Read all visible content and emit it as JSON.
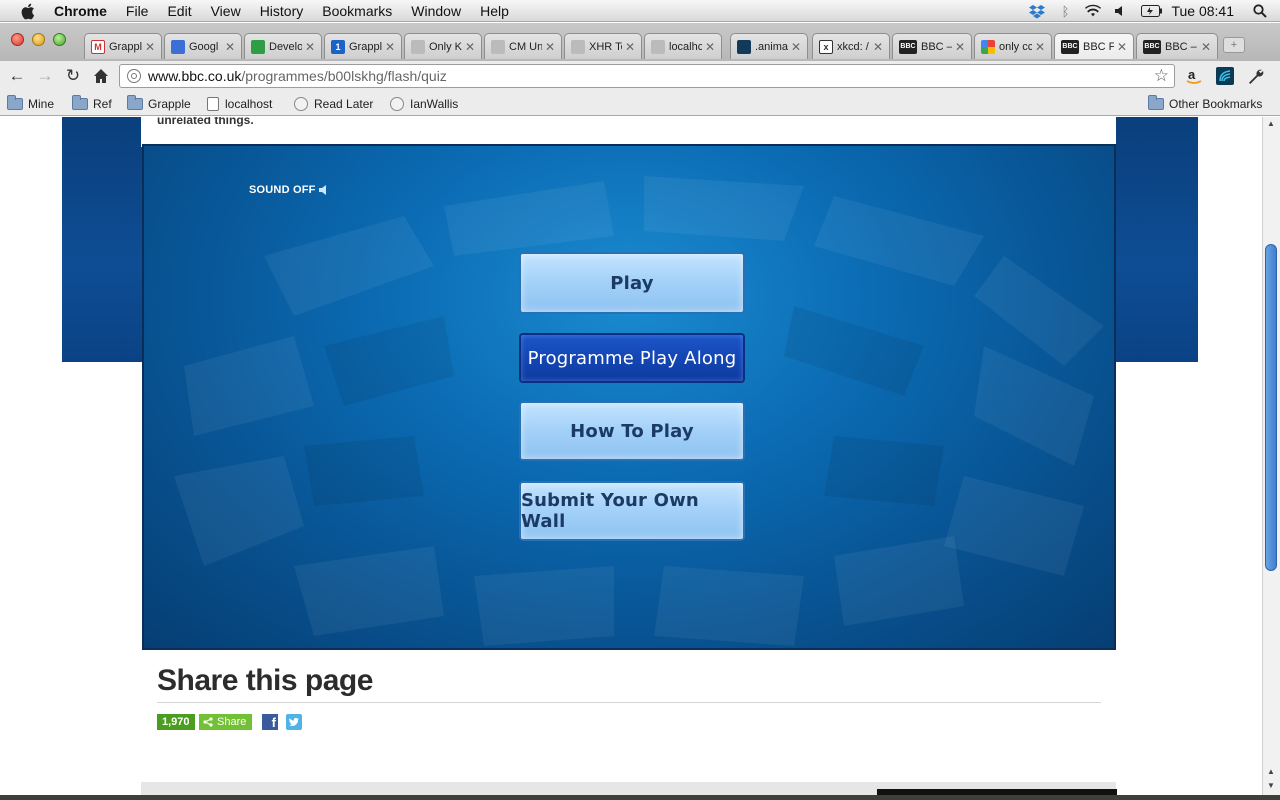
{
  "menubar": {
    "app_name": "Chrome",
    "items": [
      "File",
      "Edit",
      "View",
      "History",
      "Bookmarks",
      "Window",
      "Help"
    ],
    "clock": "Tue 08:41"
  },
  "tabs": [
    {
      "label": "Grappl",
      "icon": "gmail-icon"
    },
    {
      "label": "Googl",
      "icon": "google-docs-icon"
    },
    {
      "label": "Develo",
      "icon": "spreadsheet-icon"
    },
    {
      "label": "Grappl",
      "icon": "calendar-icon"
    },
    {
      "label": "Only K",
      "icon": "apple-icon"
    },
    {
      "label": "CM Un",
      "icon": "apple-icon"
    },
    {
      "label": "XHR Te",
      "icon": "apple-icon"
    },
    {
      "label": "localhc",
      "icon": "apple-icon"
    },
    {
      "label": ".anima",
      "icon": "swirl-icon"
    },
    {
      "label": "xkcd: /",
      "icon": "xkcd-icon"
    },
    {
      "label": "BBC – /",
      "icon": "bbc-icon"
    },
    {
      "label": "only cc",
      "icon": "google-icon"
    },
    {
      "label": "BBC Fc",
      "icon": "bbc-icon",
      "active": true
    },
    {
      "label": "BBC – I",
      "icon": "bbc-icon"
    }
  ],
  "toolbar": {
    "url_host": "www.bbc.co.uk",
    "url_path": "/programmes/b00lskhg/flash/quiz"
  },
  "bookmarks": {
    "items": [
      {
        "label": "Mine",
        "type": "folder"
      },
      {
        "label": "Ref",
        "type": "folder"
      },
      {
        "label": "Grapple",
        "type": "folder"
      },
      {
        "label": "localhost",
        "type": "page"
      },
      {
        "label": "Read Later",
        "type": "globe"
      },
      {
        "label": "IanWallis",
        "type": "globe"
      }
    ],
    "other": "Other Bookmarks"
  },
  "page": {
    "intro_text": "unrelated things.",
    "sound_label": "SOUND OFF",
    "buttons": {
      "play": "Play",
      "play_along": "Programme Play Along",
      "how_to": "How To Play",
      "submit_wall": "Submit Your Own Wall"
    },
    "share_heading": "Share this page",
    "share_count": "1,970",
    "share_label": "Share"
  },
  "colors": {
    "flash_bg": "#0b6cb4",
    "button_light": "#a2d0f8",
    "button_dark": "#1446b4",
    "share_green": "#72c033"
  }
}
